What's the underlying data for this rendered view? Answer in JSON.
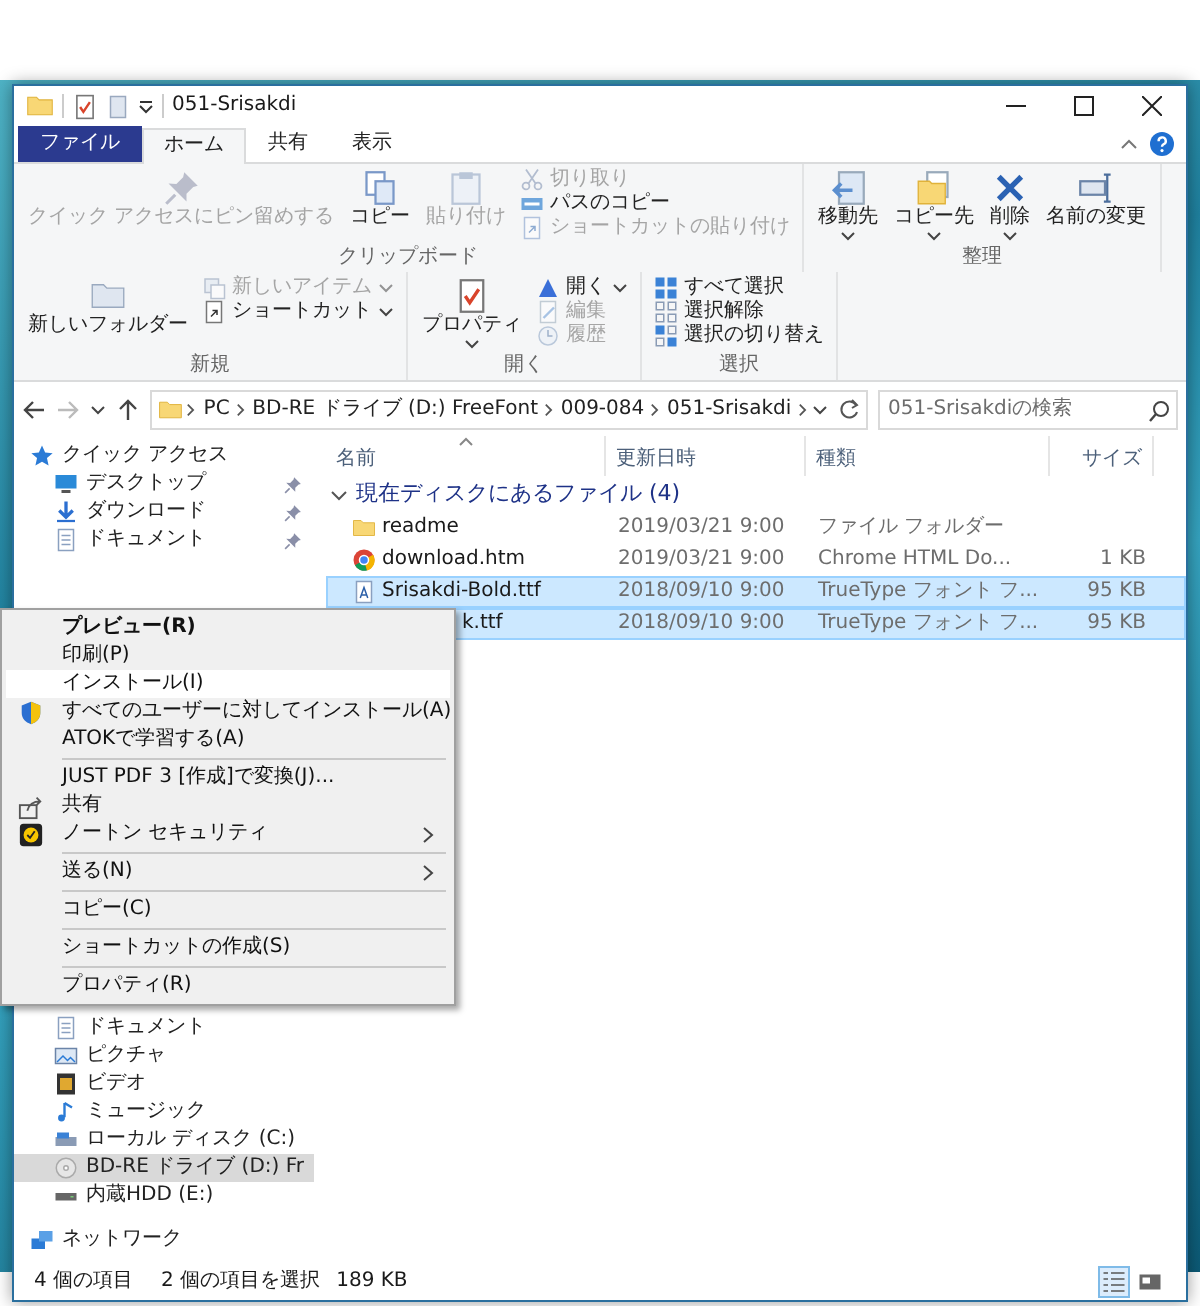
{
  "window": {
    "title": "051-Srisakdi"
  },
  "ribbon_tabs": [
    {
      "label": "ファイル",
      "kind": "file",
      "selected": false
    },
    {
      "label": "ホーム",
      "kind": "tab",
      "selected": true
    },
    {
      "label": "共有",
      "kind": "tab",
      "selected": false
    },
    {
      "label": "表示",
      "kind": "tab",
      "selected": false
    }
  ],
  "ribbon_groups": [
    {
      "label": "クリップボード",
      "buttons": [
        {
          "label": "クイック アクセスにピン留めする",
          "kind": "large",
          "disabled": true,
          "dropdown": false
        },
        {
          "label": "コピー",
          "kind": "large",
          "disabled": false,
          "dropdown": false
        },
        {
          "label": "貼り付け",
          "kind": "large",
          "disabled": true,
          "dropdown": false
        },
        {
          "label": "切り取り",
          "kind": "small",
          "disabled": true,
          "dropdown": false
        },
        {
          "label": "パスのコピー",
          "kind": "small",
          "disabled": false,
          "dropdown": false
        },
        {
          "label": "ショートカットの貼り付け",
          "kind": "small",
          "disabled": true,
          "dropdown": false
        }
      ]
    },
    {
      "label": "整理",
      "buttons": [
        {
          "label": "移動先",
          "kind": "large",
          "disabled": false,
          "dropdown": true
        },
        {
          "label": "コピー先",
          "kind": "large",
          "disabled": false,
          "dropdown": true
        },
        {
          "label": "削除",
          "kind": "large",
          "disabled": false,
          "dropdown": true
        },
        {
          "label": "名前の変更",
          "kind": "large",
          "disabled": false,
          "dropdown": false
        }
      ]
    },
    {
      "label": "新規",
      "buttons": [
        {
          "label": "新しいフォルダー",
          "kind": "large",
          "disabled": false,
          "dropdown": false
        },
        {
          "label": "新しいアイテム",
          "kind": "small",
          "disabled": true,
          "dropdown": true
        },
        {
          "label": "ショートカット",
          "kind": "small",
          "disabled": false,
          "dropdown": true
        }
      ]
    },
    {
      "label": "開く",
      "buttons": [
        {
          "label": "プロパティ",
          "kind": "large",
          "disabled": false,
          "dropdown": true
        },
        {
          "label": "開く",
          "kind": "small",
          "disabled": false,
          "dropdown": true
        },
        {
          "label": "編集",
          "kind": "small",
          "disabled": true,
          "dropdown": false
        },
        {
          "label": "履歴",
          "kind": "small",
          "disabled": true,
          "dropdown": false
        }
      ]
    },
    {
      "label": "選択",
      "buttons": [
        {
          "label": "すべて選択",
          "kind": "small",
          "disabled": false,
          "dropdown": false
        },
        {
          "label": "選択解除",
          "kind": "small",
          "disabled": false,
          "dropdown": false
        },
        {
          "label": "選択の切り替え",
          "kind": "small",
          "disabled": false,
          "dropdown": false
        }
      ]
    }
  ],
  "navigation_buttons": [
    {
      "disabled": false
    },
    {
      "disabled": true
    }
  ],
  "address": {
    "crumbs": [
      "PC",
      "BD-RE ドライブ (D:) FreeFont",
      "009-084",
      "051-Srisakdi"
    ]
  },
  "search": {
    "placeholder": "051-Srisakdiの検索"
  },
  "navigation_pane": {
    "quick_access": {
      "label": "クイック アクセス",
      "children": [
        {
          "label": "デスクトップ",
          "pinned": true
        },
        {
          "label": "ダウンロード",
          "pinned": true
        },
        {
          "label": "ドキュメント",
          "pinned": true
        }
      ]
    },
    "pc_children": [
      {
        "label": "ドキュメント",
        "selected": false
      },
      {
        "label": "ピクチャ",
        "selected": false
      },
      {
        "label": "ビデオ",
        "selected": false
      },
      {
        "label": "ミュージック",
        "selected": false
      },
      {
        "label": "ローカル ディスク (C:)",
        "selected": false
      },
      {
        "label": "BD-RE ドライブ (D:) Fr",
        "selected": true
      },
      {
        "label": "内蔵HDD (E:)",
        "selected": false
      }
    ],
    "network": {
      "label": "ネットワーク"
    }
  },
  "columns": [
    {
      "label": "名前",
      "sorted": true
    },
    {
      "label": "更新日時",
      "sorted": false
    },
    {
      "label": "種類",
      "sorted": false
    },
    {
      "label": "サイズ",
      "sorted": false
    }
  ],
  "file_group": {
    "label": "現在ディスクにあるファイル (4)",
    "expanded": true,
    "rows": [
      {
        "name": "readme",
        "date": "2019/03/21 9:00",
        "type": "ファイル フォルダー",
        "size": "",
        "selected": false,
        "covered": false
      },
      {
        "name": "download.htm",
        "date": "2019/03/21 9:00",
        "type": "Chrome HTML Do...",
        "size": "1 KB",
        "selected": false,
        "covered": false
      },
      {
        "name": "Srisakdi-Bold.ttf",
        "date": "2018/09/10 9:00",
        "type": "TrueType フォント フ...",
        "size": "95 KB",
        "selected": true,
        "covered": false
      },
      {
        "name": "k.ttf",
        "date": "2018/09/10 9:00",
        "type": "TrueType フォント フ...",
        "size": "95 KB",
        "selected": true,
        "covered": true
      }
    ]
  },
  "context_menu": [
    {
      "label": "プレビュー(R)",
      "default": true,
      "highlighted": false,
      "submenu": false,
      "separator_before": false
    },
    {
      "label": "印刷(P)",
      "default": false,
      "highlighted": false,
      "submenu": false,
      "separator_before": false
    },
    {
      "label": "インストール(I)",
      "default": false,
      "highlighted": true,
      "submenu": false,
      "separator_before": false
    },
    {
      "label": "すべてのユーザーに対してインストール(A)",
      "default": false,
      "highlighted": false,
      "submenu": false,
      "separator_before": false
    },
    {
      "label": "ATOKで学習する(A)",
      "default": false,
      "highlighted": false,
      "submenu": false,
      "separator_before": false
    },
    {
      "label": "JUST PDF 3 [作成]で変換(J)...",
      "default": false,
      "highlighted": false,
      "submenu": false,
      "separator_before": true
    },
    {
      "label": "共有",
      "default": false,
      "highlighted": false,
      "submenu": false,
      "separator_before": false
    },
    {
      "label": "ノートン セキュリティ",
      "default": false,
      "highlighted": false,
      "submenu": true,
      "separator_before": false
    },
    {
      "label": "送る(N)",
      "default": false,
      "highlighted": false,
      "submenu": true,
      "separator_before": true
    },
    {
      "label": "コピー(C)",
      "default": false,
      "highlighted": false,
      "submenu": false,
      "separator_before": true
    },
    {
      "label": "ショートカットの作成(S)",
      "default": false,
      "highlighted": false,
      "submenu": false,
      "separator_before": true
    },
    {
      "label": "プロパティ(R)",
      "default": false,
      "highlighted": false,
      "submenu": false,
      "separator_before": true
    }
  ],
  "status_bar": {
    "item_count": "4 個の項目",
    "selection": "2 個の項目を選択",
    "selection_size": "189 KB",
    "view_modes": [
      {
        "selected": true
      },
      {
        "selected": false
      }
    ]
  }
}
